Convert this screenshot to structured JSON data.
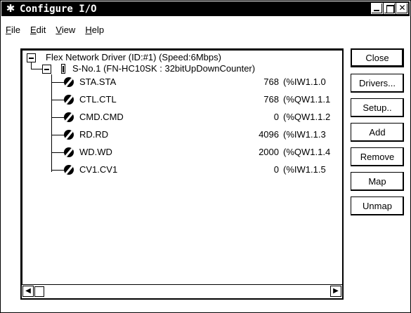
{
  "window": {
    "title": "Configure I/O",
    "icon": "gear-cross-icon"
  },
  "menu": {
    "items": [
      {
        "label": "File",
        "accel": "F"
      },
      {
        "label": "Edit",
        "accel": "E"
      },
      {
        "label": "View",
        "accel": "V"
      },
      {
        "label": "Help",
        "accel": "H"
      }
    ]
  },
  "tree": {
    "root": "Flex Network Driver (ID:#1) (Speed:6Mbps)",
    "slave": "S-No.1  (FN-HC10SK : 32bitUpDownCounter)",
    "rows": [
      {
        "name": "STA.STA",
        "value": "768",
        "address": "(%IW1.1.0"
      },
      {
        "name": "CTL.CTL",
        "value": "768",
        "address": "(%QW1.1.1"
      },
      {
        "name": "CMD.CMD",
        "value": "0",
        "address": "(%QW1.1.2"
      },
      {
        "name": "RD.RD",
        "value": "4096",
        "address": "(%IW1.1.3"
      },
      {
        "name": "WD.WD",
        "value": "2000",
        "address": "(%QW1.1.4"
      },
      {
        "name": "CV1.CV1",
        "value": "0",
        "address": "(%IW1.1.5"
      }
    ]
  },
  "buttons": {
    "close": "Close",
    "drivers": "Drivers...",
    "setup": "Setup..",
    "add": "Add",
    "remove": "Remove",
    "map": "Map",
    "unmap": "Unmap"
  }
}
